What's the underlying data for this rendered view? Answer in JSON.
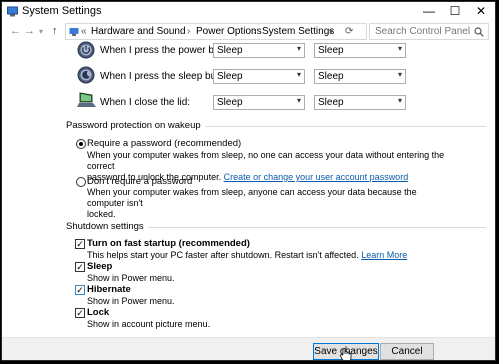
{
  "window": {
    "title": "System Settings",
    "controls": {
      "minimize": "—",
      "maximize": "☐",
      "close": "✕"
    }
  },
  "nav": {
    "back": "←",
    "forward": "→",
    "up": "↑",
    "breadcrumb_prefix": "«",
    "breadcrumb": [
      "Hardware and Sound",
      "Power Options",
      "System Settings"
    ],
    "search_placeholder": "Search Control Panel"
  },
  "power_rows": [
    {
      "label": "When I press the power button:",
      "icon": "power-button-icon",
      "on_battery": "Sleep",
      "plugged_in": "Sleep"
    },
    {
      "label": "When I press the sleep button:",
      "icon": "sleep-button-icon",
      "on_battery": "Sleep",
      "plugged_in": "Sleep"
    },
    {
      "label": "When I close the lid:",
      "icon": "laptop-lid-icon",
      "on_battery": "Sleep",
      "plugged_in": "Sleep"
    }
  ],
  "password_section": {
    "title": "Password protection on wakeup",
    "require": {
      "label": "Require a password (recommended)",
      "desc_line1": "When your computer wakes from sleep, no one can access your data without entering the correct",
      "desc_line2_prefix": "password to unlock the computer.",
      "link": "Create or change your user account password",
      "selected": true
    },
    "no_require": {
      "label": "Don't require a password",
      "desc_line1": "When your computer wakes from sleep, anyone can access your data because the computer isn't",
      "desc_line2": "locked.",
      "selected": false
    }
  },
  "shutdown_section": {
    "title": "Shutdown settings",
    "items": [
      {
        "label": "Turn on fast startup (recommended)",
        "desc": "This helps start your PC faster after shutdown. Restart isn't affected.",
        "link": "Learn More",
        "checked": true
      },
      {
        "label": "Sleep",
        "desc": "Show in Power menu.",
        "checked": true
      },
      {
        "label": "Hibernate",
        "desc": "Show in Power menu.",
        "checked": true
      },
      {
        "label": "Lock",
        "desc": "Show in account picture menu.",
        "checked": true
      }
    ]
  },
  "footer": {
    "save_label": "Save changes",
    "cancel_label": "Cancel"
  }
}
